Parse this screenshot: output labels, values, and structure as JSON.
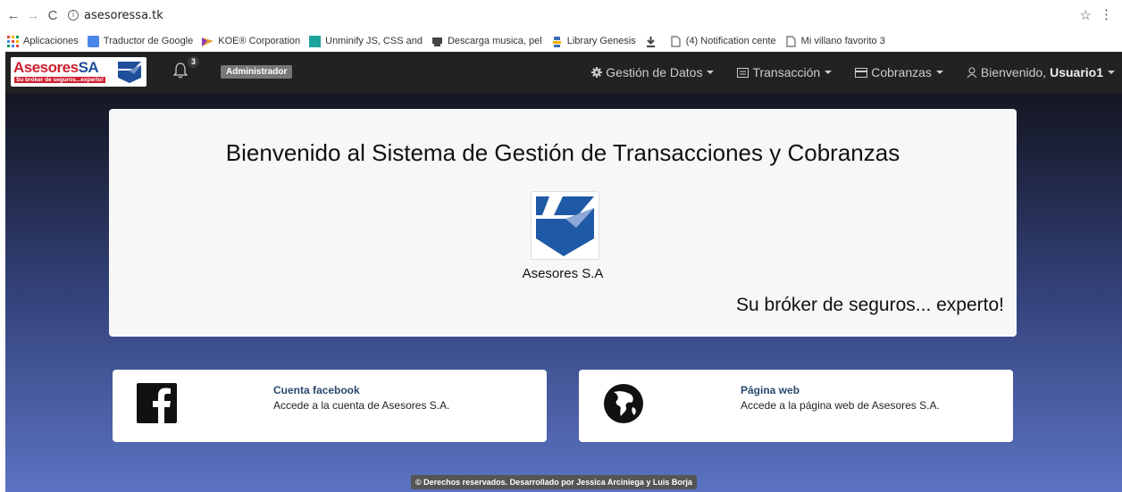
{
  "browser": {
    "url": "asesoressa.tk",
    "bookmarks": [
      {
        "label": "Aplicaciones",
        "icon": "apps-grid-icon",
        "color": "#e04a3a"
      },
      {
        "label": "Traductor de Google",
        "icon": "translate-icon",
        "color": "#4a86e8"
      },
      {
        "label": "KOE® Corporation",
        "icon": "koe-logo-icon",
        "color": "#e8a030"
      },
      {
        "label": "Unminify JS, CSS and",
        "icon": "unminify-icon",
        "color": "#1ba39c"
      },
      {
        "label": "Descarga musica, pel",
        "icon": "download-site-icon",
        "color": "#444444"
      },
      {
        "label": "Library Genesis",
        "icon": "library-icon",
        "color": "#3b6fb6"
      },
      {
        "label": "",
        "icon": "download-arrow-icon",
        "color": "#444444"
      },
      {
        "label": "(4) Notification cente",
        "icon": "page-icon",
        "color": "#666666"
      },
      {
        "label": "Mi villano favorito 3",
        "icon": "page-icon",
        "color": "#666666"
      }
    ]
  },
  "navbar": {
    "brand_name_red": "Asesores",
    "brand_name_blue": "SA",
    "brand_tagline": "Su bróker de seguros...experto!",
    "notifications_count": "3",
    "role": "Administrador",
    "menu": {
      "gestion": "Gestión de Datos",
      "transaccion": "Transacción",
      "cobranzas": "Cobranzas",
      "welcome_prefix": "Bienvenido,",
      "username": "Usuario1"
    }
  },
  "jumbotron": {
    "title": "Bienvenido al Sistema de Gestión de Transacciones y Cobranzas",
    "logo_caption": "Asesores S.A",
    "slogan": "Su bróker de seguros... experto!"
  },
  "cards": {
    "facebook": {
      "title": "Cuenta facebook",
      "description": "Accede a la cuenta de Asesores S.A."
    },
    "web": {
      "title": "Página web",
      "description": "Accede a la página web de Asesores S.A."
    }
  },
  "footer": "© Derechos reservados. Desarrollado por Jessica Arciniega y Luis Borja",
  "colors": {
    "brand_red": "#cc1f2f",
    "brand_blue": "#1f4e9a",
    "navbar_bg": "#222222",
    "card_title": "#2a4a6e"
  }
}
